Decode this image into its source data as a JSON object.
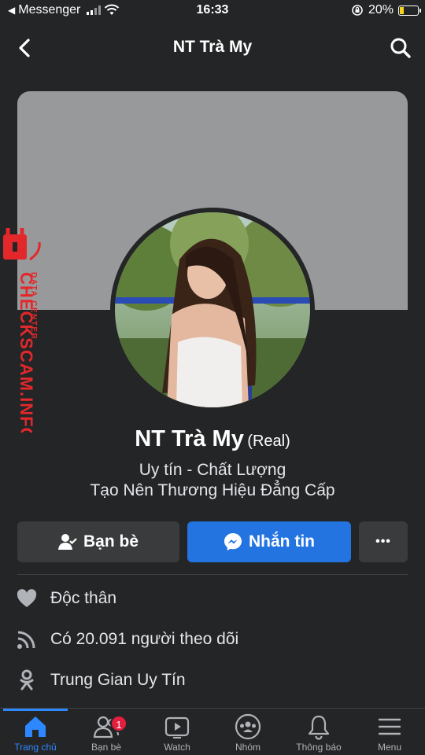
{
  "status_bar": {
    "carrier": "Messenger",
    "time": "16:33",
    "battery": "20%",
    "icons": [
      "signal-icon",
      "wifi-icon",
      "lock-rotation-icon",
      "battery-charging-icon"
    ]
  },
  "header": {
    "title": "NT Trà My",
    "icons": [
      "back-arrow-icon",
      "search-icon"
    ]
  },
  "profile": {
    "name": "NT Trà My",
    "name_tag": "(Real)",
    "bio_line1": "Uy tín - Chất Lượng",
    "bio_line2": "Tạo Nên Thương Hiệu Đẳng Cấp"
  },
  "watermark": {
    "brand": "CHECKSCAM.INFO",
    "sub": "DATA CENTER",
    "color": "#e3282b"
  },
  "actions": {
    "friends_label": "Bạn bè",
    "message_label": "Nhắn tin",
    "more_label": "•••"
  },
  "info": {
    "relationship": "Độc thân",
    "followers": "Có 20.091 người theo dõi",
    "other": "Trung Gian Uy Tín"
  },
  "bottom_nav": {
    "items": [
      {
        "label": "Trang chủ",
        "icon": "home-icon",
        "active": true
      },
      {
        "label": "Bạn bè",
        "icon": "friends-icon",
        "badge": "1"
      },
      {
        "label": "Watch",
        "icon": "watch-icon"
      },
      {
        "label": "Nhóm",
        "icon": "groups-icon"
      },
      {
        "label": "Thông báo",
        "icon": "bell-icon"
      },
      {
        "label": "Menu",
        "icon": "menu-icon"
      }
    ]
  },
  "colors": {
    "background": "#242526",
    "primary": "#2374e1",
    "active_nav": "#2d88ff",
    "badge": "#e41e3f"
  }
}
